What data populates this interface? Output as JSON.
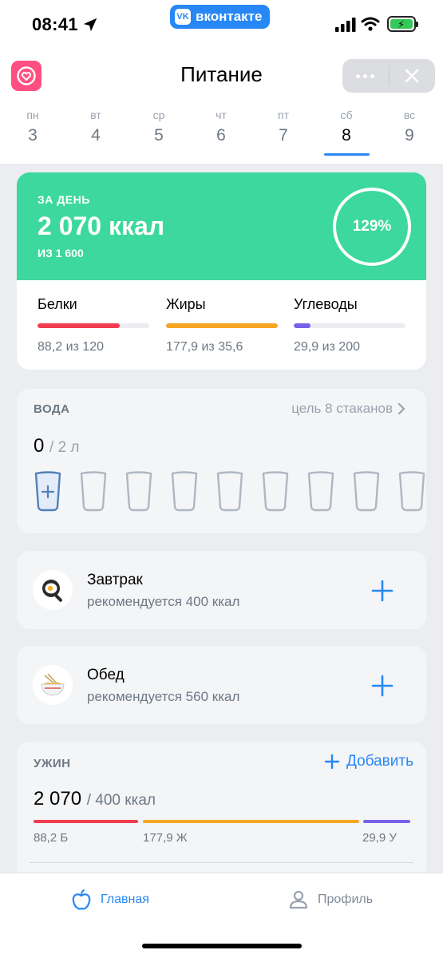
{
  "status_bar": {
    "time": "08:41",
    "app_banner": "вконтакте",
    "app_logo": "VK"
  },
  "header": {
    "title": "Питание"
  },
  "week": [
    {
      "dn": "пн",
      "dd": "3"
    },
    {
      "dn": "вт",
      "dd": "4"
    },
    {
      "dn": "ср",
      "dd": "5"
    },
    {
      "dn": "чт",
      "dd": "6"
    },
    {
      "dn": "пт",
      "dd": "7"
    },
    {
      "dn": "сб",
      "dd": "8",
      "active": true
    },
    {
      "dn": "вс",
      "dd": "9"
    }
  ],
  "summary": {
    "label": "ЗА ДЕНЬ",
    "value": "2 070 ккал",
    "sub": "ИЗ 1 600",
    "percent": "129%",
    "accent": "#3dd89d",
    "macros": [
      {
        "name": "Белки",
        "value": "88,2 из 120",
        "fill": 0.735,
        "color": "#f23c4f"
      },
      {
        "name": "Жиры",
        "value": "177,9 из 35,6",
        "fill": 1.0,
        "color": "#f5a623"
      },
      {
        "name": "Углеводы",
        "value": "29,9 из 200",
        "fill": 0.15,
        "color": "#7b61e8"
      }
    ]
  },
  "water": {
    "title": "ВОДА",
    "goal": "цель 8 стаканов",
    "amount": "0",
    "unit": "/ 2 л",
    "glass_count": 9
  },
  "meals": [
    {
      "name": "Завтрак",
      "rec": "рекомендуется 400 ккал",
      "icon": "fried-egg-icon"
    },
    {
      "name": "Обед",
      "rec": "рекомендуется 560 ккал",
      "icon": "noodle-bowl-icon"
    }
  ],
  "dinner": {
    "title": "УЖИН",
    "add_label": "Добавить",
    "amount": "2 070",
    "unit": "/ 400 ккал",
    "protein": "88,2 Б",
    "fat": "177,9 Ж",
    "carbs": "29,9 У"
  },
  "tabs": {
    "home": "Главная",
    "profile": "Профиль"
  },
  "colors": {
    "accent": "#2787f5",
    "protein": "#f23c4f",
    "fat": "#f5a623",
    "carbs": "#7b61e8"
  }
}
